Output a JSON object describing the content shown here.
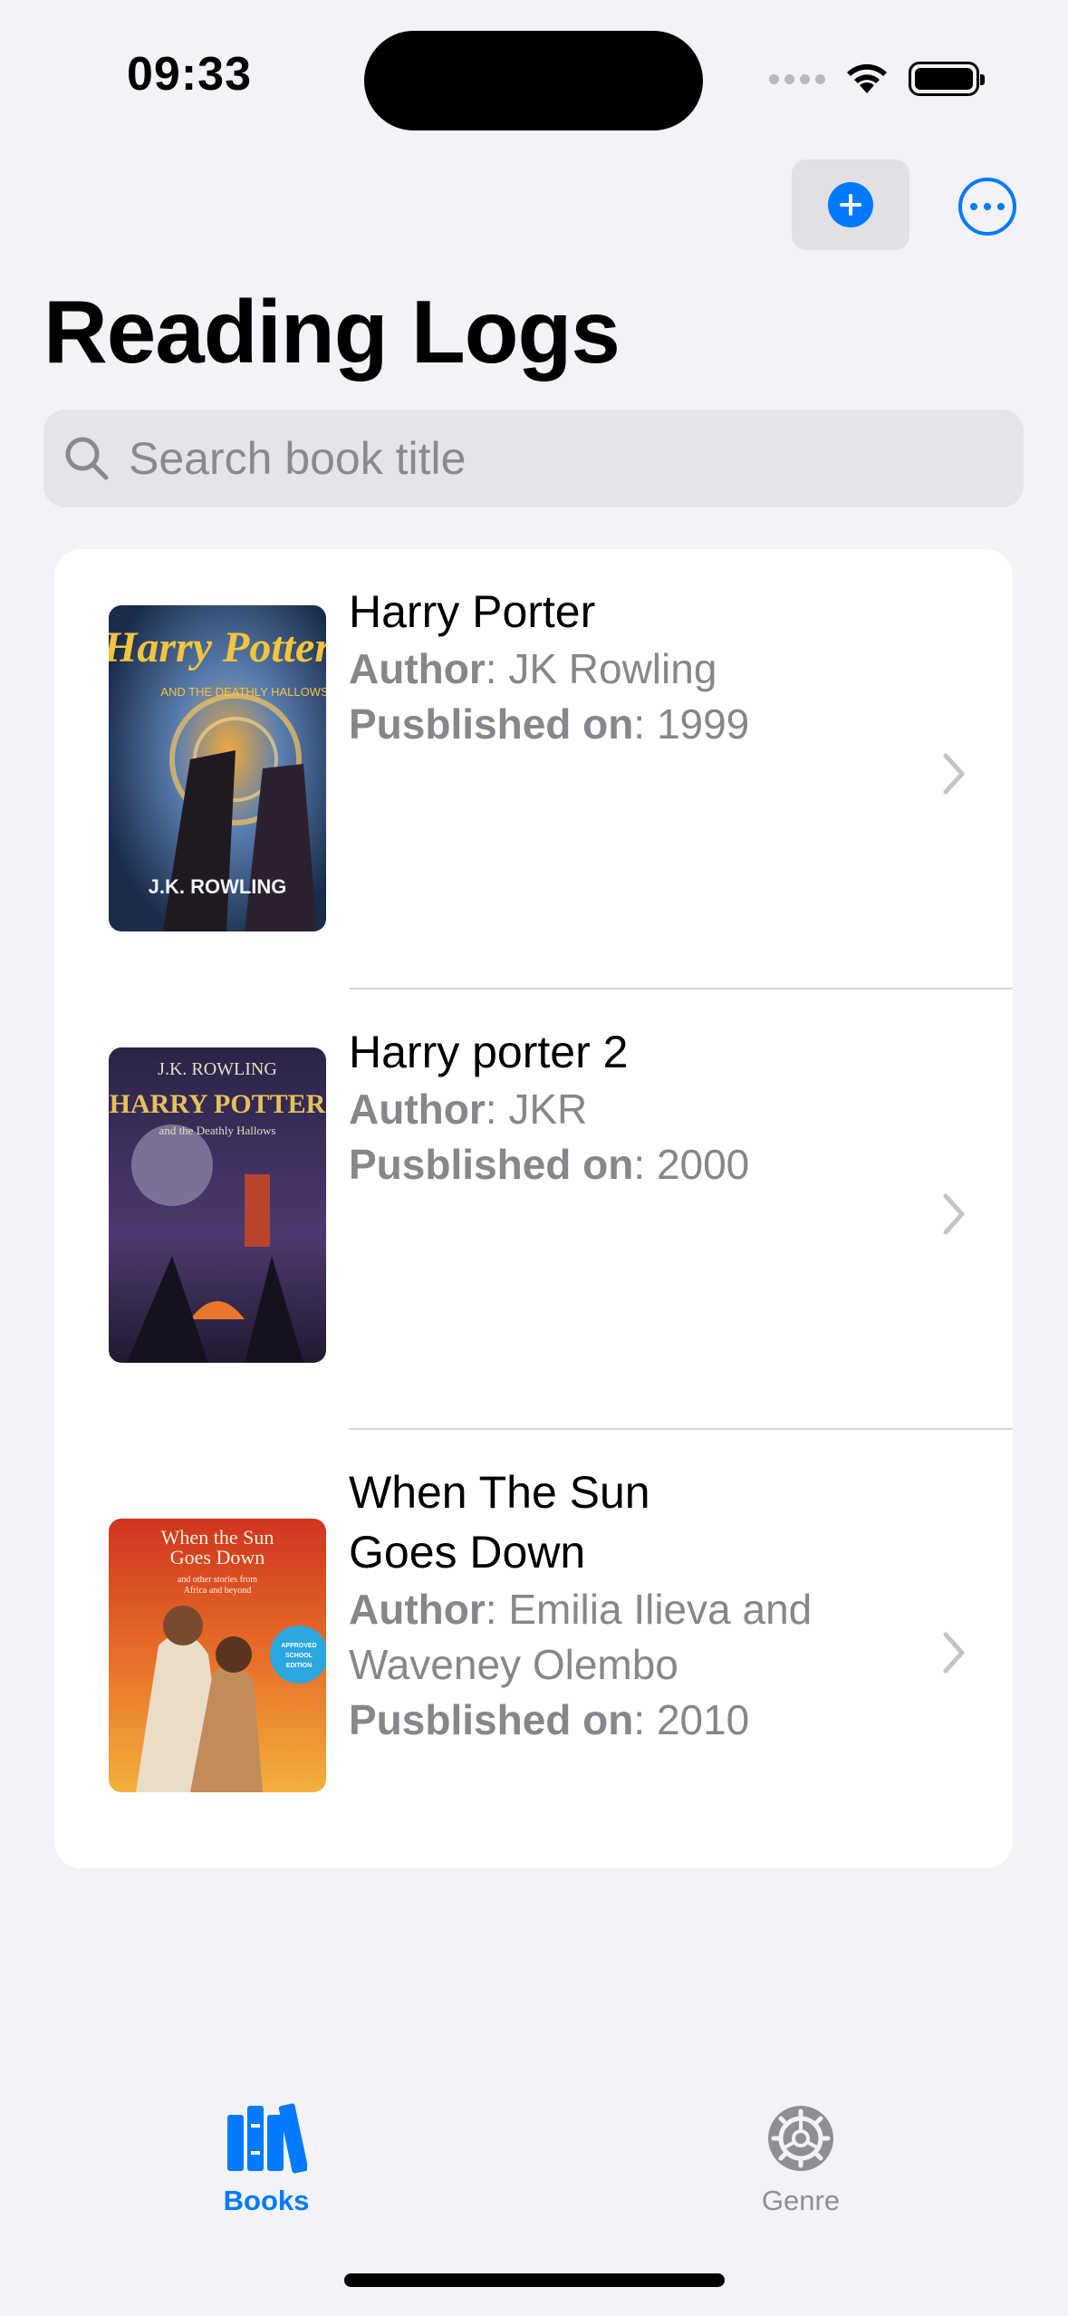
{
  "status_bar": {
    "time": "09:33"
  },
  "nav": {
    "title": "Reading Logs",
    "add_icon": "plus-circle-icon",
    "more_icon": "ellipsis-circle-icon"
  },
  "search": {
    "placeholder": "Search book title",
    "value": "",
    "icon": "magnifying-glass-icon"
  },
  "books": [
    {
      "title": "Harry Porter",
      "author_label": "Author",
      "author": "JK Rowling",
      "published_label": "Pusblished on",
      "published": "1999"
    },
    {
      "title": "Harry porter 2",
      "author_label": "Author",
      "author": "JKR",
      "published_label": "Pusblished on",
      "published": "2000"
    },
    {
      "title": "When The Sun Goes Down",
      "author_label": "Author",
      "author": "Emilia Ilieva and Waveney Olembo",
      "published_label": "Pusblished on",
      "published": "2010"
    }
  ],
  "covers": [
    {
      "top_text": "Harry Potter",
      "mid_text": "AND THE DEATHLY HALLOWS",
      "bottom_text": "J.K. ROWLING"
    },
    {
      "top_text": "J.K. ROWLING",
      "mid_text": "HARRY POTTER",
      "bottom_text": "and the Deathly Hallows"
    },
    {
      "top_text": "When the Sun Goes Down",
      "mid_text": "and other stories from Africa and beyond",
      "badge": "APPROVED SCHOOL EDITION"
    }
  ],
  "tab_bar": {
    "tabs": [
      {
        "label": "Books",
        "icon": "books-icon",
        "active": true
      },
      {
        "label": "Genre",
        "icon": "gear-icon",
        "active": false
      }
    ]
  },
  "colors": {
    "accent": "#007aff",
    "background": "#f2f2f7",
    "secondary_text": "#86868b"
  }
}
